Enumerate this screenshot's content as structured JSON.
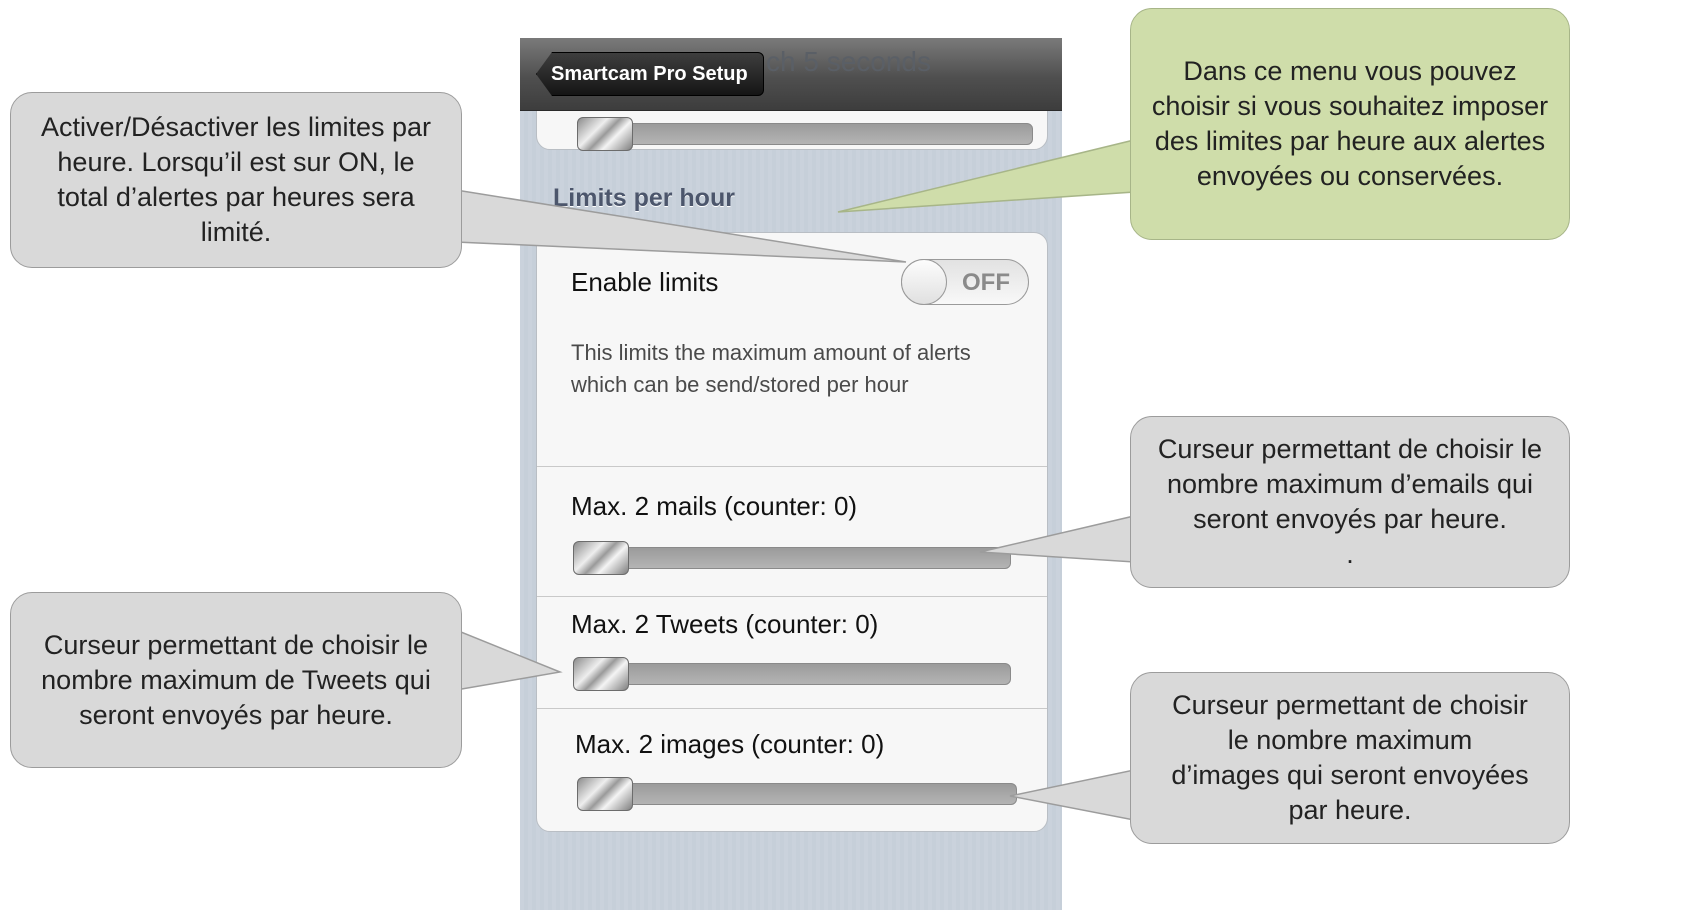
{
  "navbar": {
    "back_label": "Smartcam Pro Setup",
    "title_fragment": "ch 5 seconds"
  },
  "section_header": "Limits per hour",
  "enable_limits": {
    "label": "Enable limits",
    "switch_state": "OFF",
    "description": "This limits the maximum amount of alerts which can be send/stored per hour"
  },
  "sliders": [
    {
      "label": "Max. 2 mails (counter: 0)",
      "value": 0
    },
    {
      "label": "Max. 2 Tweets (counter: 0)",
      "value": 0
    },
    {
      "label": "Max. 2 images (counter: 0)",
      "value": 0
    }
  ],
  "callouts": {
    "left_top": "Activer/Désactiver les limites par heure. Lorsqu’il est sur ON, le total d’alertes par heures sera limité.",
    "right_top": "Dans ce menu vous pouvez choisir si vous souhaitez imposer des limites par heure aux alertes envoyées ou conservées.",
    "right_mid": "Curseur permettant de choisir le nombre maximum d’emails qui seront envoyés par heure.",
    "right_mid_extra": ".",
    "left_bottom": "Curseur permettant de choisir le nombre maximum de Tweets qui seront envoyés par heure.",
    "right_bottom": "Curseur permettant de choisir le nombre maximum d’images qui seront envoyées par heure."
  },
  "colors": {
    "callout_grey": "#d9d9d9",
    "callout_green": "#cfddaa",
    "section_header": "#4c566c"
  }
}
